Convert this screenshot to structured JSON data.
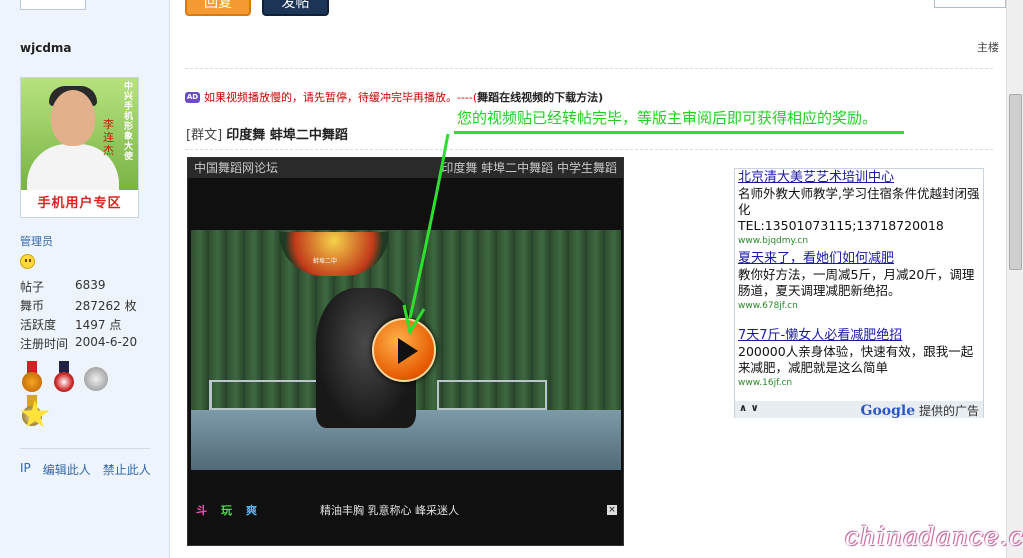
{
  "sidebar": {
    "username": "wjcdma",
    "avatar": {
      "side_text": "中兴手机形象大使",
      "signature": "李连杰",
      "banner": "手机用户专区"
    },
    "role": "管理员",
    "stats": [
      {
        "label": "帖子",
        "value": "6839"
      },
      {
        "label": "舞币",
        "value": "287262 枚"
      },
      {
        "label": "活跃度",
        "value": "1497 点"
      },
      {
        "label": "注册时间",
        "value": "2004-6-20"
      }
    ],
    "links": [
      "IP",
      "编辑此人",
      "禁止此人"
    ]
  },
  "top_buttons": [
    "回复",
    "发帖"
  ],
  "post": {
    "floor": "主楼",
    "notice": {
      "ad_icon": "AD",
      "text": "如果视频播放慢的，请先暂停，待缓冲完毕再播放。----(",
      "link": "舞蹈在线视频的下载方法",
      "tail": ")"
    },
    "tag": "[群文]",
    "title": "印度舞  蚌埠二中舞蹈",
    "overlay_message": "您的视频贴已经转帖完毕，等版主审阅后即可获得相应的奖励。"
  },
  "player": {
    "header_left": "中国舞蹈网论坛",
    "header_right": "印度舞  蚌埠二中舞蹈  中学生舞蹈",
    "stage_sign": "蚌埠二中",
    "footer_icons": [
      "斗",
      "玩",
      "爽"
    ],
    "footer_text": "精油丰胸  乳意称心  峰采迷人",
    "close": "×"
  },
  "ads": {
    "items": [
      {
        "title": "北京清大美艺艺术培训中心",
        "body": "名师外教大师教学,学习住宿条件优越封闭强化",
        "body2": "TEL:13501073115;13718720018",
        "url": "www.bjqdmy.cn"
      },
      {
        "title": "夏天来了，看她们如何减肥",
        "body": "教你好方法，一周减5斤，月减20斤，调理肠道，夏天调理减肥新绝招。",
        "url": "www.678jf.cn"
      },
      {
        "title": "7天7斤-懒女人必看减肥绝招",
        "body": "200000人亲身体验，快速有效，跟我一起来减肥，减肥就是这么简单",
        "url": "www.16jf.cn"
      }
    ],
    "nav": "∧ ∨",
    "google": "Google",
    "provided": "提供的广告"
  },
  "watermark": "chinadance.cn",
  "colors": {
    "overlay_green": "#1fd11f",
    "notice_red": "#cc0000",
    "link_blue": "#3366aa",
    "ad_title": "#1a1aa6"
  }
}
